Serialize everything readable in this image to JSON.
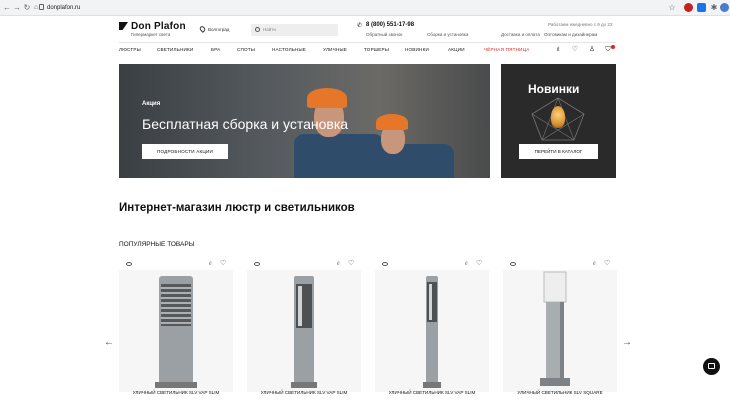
{
  "browser": {
    "url": "donplafon.ru",
    "nav": [
      "←",
      "→",
      "↻",
      "⌂"
    ]
  },
  "header": {
    "logo": "Don Plafon",
    "logo_sub": "Гипермаркет света",
    "city": "Волгоград",
    "search_placeholder": "Найти",
    "phone": "8 (800) 551-17-98",
    "callback": "Обратный звонок",
    "links": [
      "Сборка и установка",
      "Доставка и оплата",
      "Оптовикам и дизайнерам"
    ],
    "hours": "Работаем ежедневно с 9 до 23"
  },
  "menu": {
    "items": [
      "ЛЮСТРЫ",
      "СВЕТИЛЬНИКИ",
      "БРА",
      "СПОТЫ",
      "НАСТОЛЬНЫЕ",
      "УЛИЧНЫЕ",
      "ТОРШЕРЫ",
      "НОВИНКИ",
      "АКЦИИ",
      "ЧЁРНАЯ ПЯТНИЦА"
    ],
    "icons": [
      "compare-icon",
      "heart-icon",
      "user-icon",
      "cart-icon"
    ]
  },
  "banner_main": {
    "tag": "Акция",
    "title": "Бесплатная сборка и установка",
    "button": "ПОДРОБНОСТИ АКЦИИ"
  },
  "banner_side": {
    "title": "Новинки",
    "button": "ПЕРЕЙТИ В КАТАЛОГ"
  },
  "main_heading": "Интернет-магазин люстр и светильников",
  "popular_heading": "ПОПУЛЯРНЫЕ ТОВАРЫ",
  "products": [
    {
      "name": "УЛИЧНЫЙ СВЕТИЛЬНИК SLV VAP SLIM"
    },
    {
      "name": "УЛИЧНЫЙ СВЕТИЛЬНИК SLV VAP SLIM"
    },
    {
      "name": "УЛИЧНЫЙ СВЕТИЛЬНИК SLV VAP SLIM"
    },
    {
      "name": "УЛИЧНЫЙ СВЕТИЛЬНИК SLV SQUARE"
    }
  ],
  "colors": {
    "accent": "#e2231a",
    "dark": "#111111"
  }
}
